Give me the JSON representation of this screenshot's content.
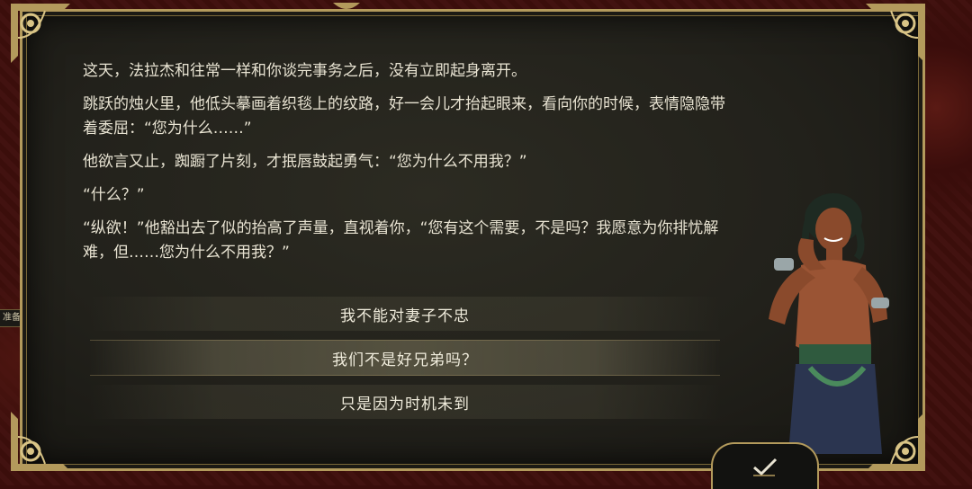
{
  "dialogue": {
    "paragraphs": [
      "这天，法拉杰和往常一样和你谈完事务之后，没有立即起身离开。",
      "跳跃的烛火里，他低头摹画着织毯上的纹路，好一会儿才抬起眼来，看向你的时候，表情隐隐带着委屈：“您为什么……”",
      "他欲言又止，踟蹰了片刻，才抿唇鼓起勇气：“您为什么不用我？”",
      "“什么？”",
      "“纵欲！”他豁出去了似的抬高了声量，直视着你，“您有这个需要，不是吗？我愿意为你排忧解难，但……您为什么不用我？”"
    ]
  },
  "choices": [
    {
      "label": "我不能对妻子不忠",
      "selected": false
    },
    {
      "label": "我们不是好兄弟吗？",
      "selected": true
    },
    {
      "label": "只是因为时机未到",
      "selected": false
    }
  ],
  "side_tab": {
    "label": "准备"
  },
  "confirm": {
    "icon": "checkmark-icon"
  },
  "colors": {
    "gold": "#b39a5c",
    "text": "#e8e3d2",
    "panel": "#22211b",
    "background": "#3a0d0b"
  }
}
